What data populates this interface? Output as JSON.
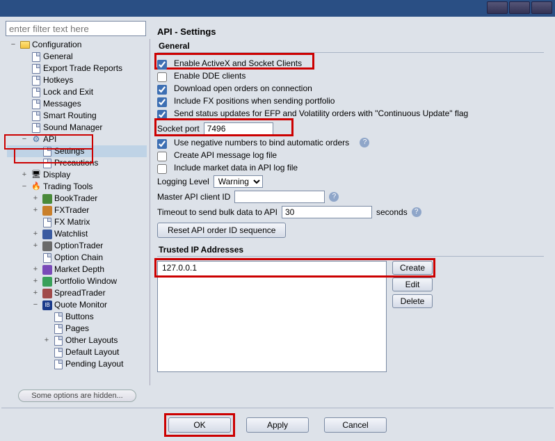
{
  "filter_placeholder": "enter filter text here",
  "tree": {
    "root": "Configuration",
    "items": [
      {
        "label": "General",
        "indent": 1,
        "icon": "page"
      },
      {
        "label": "Export Trade Reports",
        "indent": 1,
        "icon": "page"
      },
      {
        "label": "Hotkeys",
        "indent": 1,
        "icon": "page"
      },
      {
        "label": "Lock and Exit",
        "indent": 1,
        "icon": "page"
      },
      {
        "label": "Messages",
        "indent": 1,
        "icon": "page"
      },
      {
        "label": "Smart Routing",
        "indent": 1,
        "icon": "page"
      },
      {
        "label": "Sound Manager",
        "indent": 1,
        "icon": "page"
      },
      {
        "label": "API",
        "indent": 1,
        "icon": "api",
        "expand": "-"
      },
      {
        "label": "Settings",
        "indent": 2,
        "icon": "page",
        "selected": true
      },
      {
        "label": "Precautions",
        "indent": 2,
        "icon": "page"
      },
      {
        "label": "Display",
        "indent": 1,
        "icon": "display",
        "expand": "+"
      },
      {
        "label": "Trading Tools",
        "indent": 1,
        "icon": "trading",
        "expand": "-"
      },
      {
        "label": "BookTrader",
        "indent": 2,
        "icon": "c",
        "color": "#4a8a3a",
        "expand": "+"
      },
      {
        "label": "FXTrader",
        "indent": 2,
        "icon": "c",
        "color": "#c97f2b",
        "expand": "+"
      },
      {
        "label": "FX Matrix",
        "indent": 2,
        "icon": "page"
      },
      {
        "label": "Watchlist",
        "indent": 2,
        "icon": "c",
        "color": "#3a5aa0",
        "expand": "+"
      },
      {
        "label": "OptionTrader",
        "indent": 2,
        "icon": "c",
        "color": "#6a6a6a",
        "expand": "+"
      },
      {
        "label": "Option Chain",
        "indent": 2,
        "icon": "page"
      },
      {
        "label": "Market Depth",
        "indent": 2,
        "icon": "c",
        "color": "#7a4ab8",
        "expand": "+"
      },
      {
        "label": "Portfolio Window",
        "indent": 2,
        "icon": "c",
        "color": "#3aa05a",
        "expand": "+"
      },
      {
        "label": "SpreadTrader",
        "indent": 2,
        "icon": "c",
        "color": "#a04a4a",
        "expand": "+"
      },
      {
        "label": "Quote Monitor",
        "indent": 2,
        "icon": "ib",
        "expand": "-"
      },
      {
        "label": "Buttons",
        "indent": 3,
        "icon": "page"
      },
      {
        "label": "Pages",
        "indent": 3,
        "icon": "page"
      },
      {
        "label": "Other Layouts",
        "indent": 3,
        "icon": "page",
        "expand": "+"
      },
      {
        "label": "Default Layout",
        "indent": 3,
        "icon": "page"
      },
      {
        "label": "Pending Layout",
        "indent": 3,
        "icon": "page"
      }
    ]
  },
  "hidden_hint": "Some options are hidden...",
  "header": "API - Settings",
  "group_general": "General",
  "chk": {
    "activex": "Enable ActiveX and Socket Clients",
    "dde": "Enable DDE clients",
    "download": "Download open orders on connection",
    "fx": "Include FX positions when sending portfolio",
    "efp": "Send status updates for EFP and Volatility orders with \"Continuous Update\" flag",
    "neg": "Use negative numbers to bind automatic orders",
    "msglog": "Create API message log file",
    "mktlog": "Include market data in API log file"
  },
  "checked": {
    "activex": true,
    "dde": false,
    "download": true,
    "fx": true,
    "efp": true,
    "neg": true,
    "msglog": false,
    "mktlog": false
  },
  "socket_label": "Socket port",
  "socket_value": "7496",
  "loglevel_label": "Logging Level",
  "loglevel_value": "Warning",
  "master_label": "Master API client ID",
  "master_value": "",
  "timeout_label": "Timeout to send bulk data to API",
  "timeout_value": "30",
  "timeout_unit": "seconds",
  "reset_btn": "Reset API order ID sequence",
  "trusted_label": "Trusted IP Addresses",
  "ips": [
    "127.0.0.1"
  ],
  "btns": {
    "create": "Create",
    "edit": "Edit",
    "delete": "Delete"
  },
  "footer": {
    "ok": "OK",
    "apply": "Apply",
    "cancel": "Cancel"
  }
}
